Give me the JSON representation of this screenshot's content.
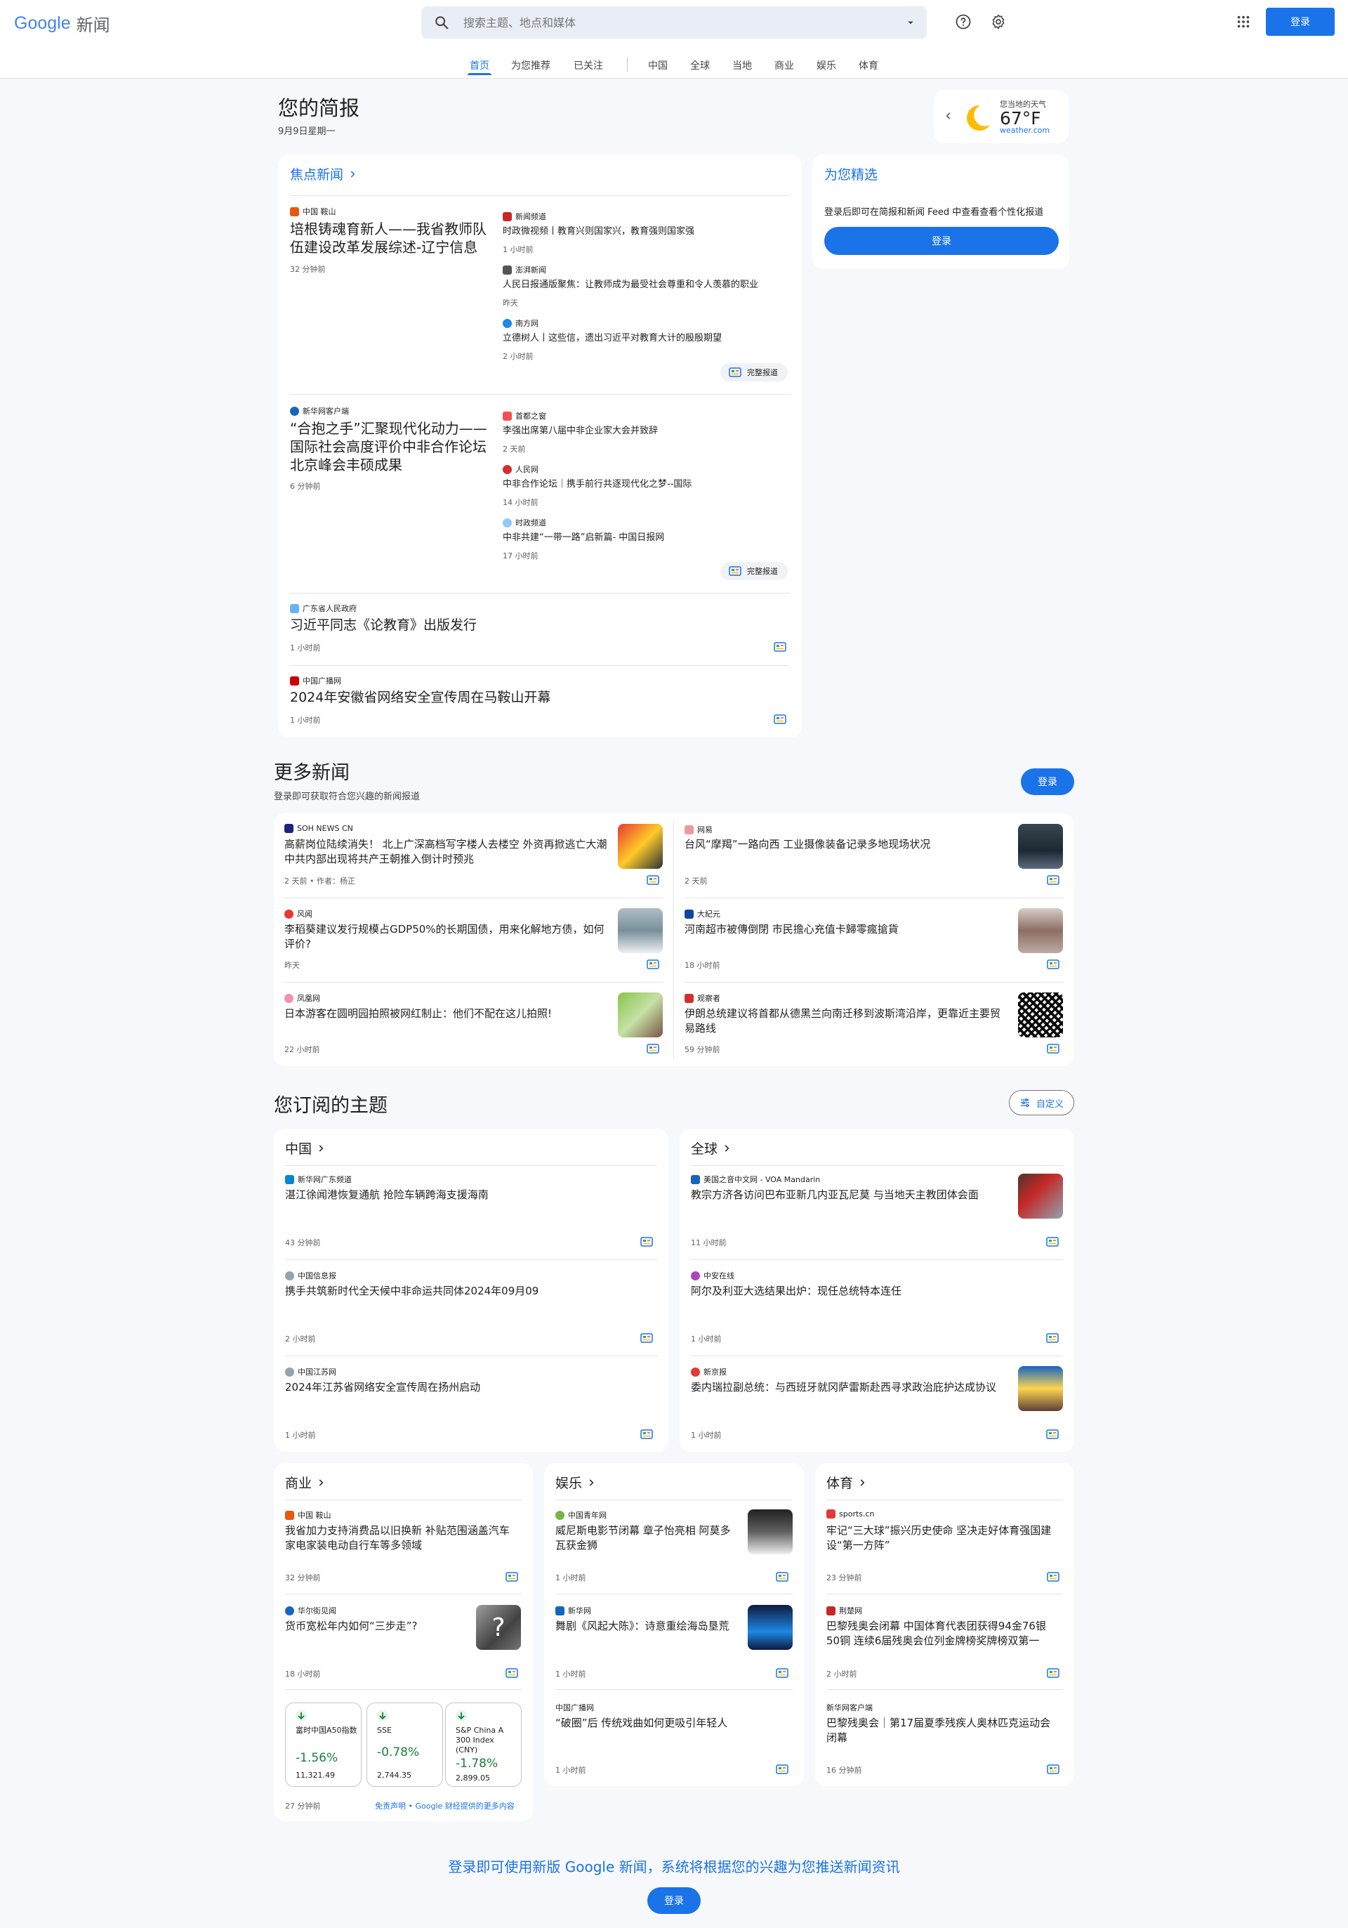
{
  "header": {
    "logo_google": "Google",
    "logo_news": "新闻",
    "search_placeholder": "搜索主题、地点和媒体",
    "signin": "登录",
    "tabs": [
      "首页",
      "为您推荐",
      "已关注",
      "中国",
      "全球",
      "当地",
      "商业",
      "娱乐",
      "体育"
    ],
    "active_tab": "首页"
  },
  "briefing": {
    "title": "您的简报",
    "date": "9月9日星期一"
  },
  "weather": {
    "label": "您当地的天气",
    "temp": "67°F",
    "source": "weather.com"
  },
  "top_stories": {
    "heading": "焦点新闻",
    "full_coverage": "完整报道",
    "clusters": [
      {
        "main": {
          "source": "中国 鞍山",
          "title": "培根铸魂育新人——我省教师队伍建设改革发展综述-辽宁信息",
          "time": "32 分钟前"
        },
        "related": [
          {
            "source": "新闻频道",
            "title": "时政微视频丨教育兴则国家兴，教育强则国家强",
            "time": "1 小时前"
          },
          {
            "source": "澎湃新闻",
            "title": "人民日报通版聚焦：让教师成为最受社会尊重和令人羡慕的职业",
            "time": "昨天"
          },
          {
            "source": "南方网",
            "title": "立德树人丨这些信，遗出习近平对教育大计的殷殷期望",
            "time": "2 小时前"
          }
        ]
      },
      {
        "main": {
          "source": "新华网客户端",
          "title": "“合抱之手”汇聚现代化动力——国际社会高度评价中非合作论坛北京峰会丰硕成果",
          "time": "6 分钟前"
        },
        "related": [
          {
            "source": "首都之窗",
            "title": "李强出席第八届中非企业家大会并致辞",
            "time": "2 天前"
          },
          {
            "source": "人民网",
            "title": "中非合作论坛｜携手前行共逐现代化之梦--国际",
            "time": "14 小时前"
          },
          {
            "source": "时政频道",
            "title": "中非共建“一带一路”启新篇- 中国日报网",
            "time": "17 小时前"
          }
        ]
      }
    ],
    "singles": [
      {
        "source": "广东省人民政府",
        "title": "习近平同志《论教育》出版发行",
        "time": "1 小时前"
      },
      {
        "source": "中国广播网",
        "title": "2024年安徽省网络安全宣传周在马鞍山开幕",
        "time": "1 小时前"
      }
    ]
  },
  "picks": {
    "title": "为您精选",
    "text": "登录后即可在简报和新闻 Feed 中查看查看个性化报道",
    "button": "登录"
  },
  "more_news": {
    "title": "更多新闻",
    "subtitle": "登录即可获取符合您兴趣的新闻报道",
    "button": "登录",
    "items": [
      {
        "source": "SOH NEWS CN",
        "title": "高薪岗位陆续消失！ 北上广深高档写字楼人去楼空 外资再掀逃亡大潮 中共内部出现将共产王朝推入倒计时预兆",
        "time": "2 天前 • 作者：杨正"
      },
      {
        "source": "网易",
        "title": "台风“摩羯”一路向西 工业摄像装备记录多地现场状况",
        "time": "2 天前"
      },
      {
        "source": "风闻",
        "title": "李稻葵建议发行规模占GDP50%的长期国债，用来化解地方债，如何评价?",
        "time": "昨天"
      },
      {
        "source": "大紀元",
        "title": "河南超市被傳倒閉 市民擔心充值卡歸零瘋搶貨",
        "time": "18 小时前"
      },
      {
        "source": "凤凰网",
        "title": "日本游客在圆明园拍照被网红制止：他们不配在这儿拍照!",
        "time": "22 小时前"
      },
      {
        "source": "观察者",
        "title": "伊朗总统建议将首都从德黑兰向南迁移到波斯湾沿岸，更靠近主要贸易路线",
        "time": "59 分钟前"
      }
    ]
  },
  "topics": {
    "title": "您订阅的主题",
    "customize": "自定义",
    "china": {
      "heading": "中国",
      "items": [
        {
          "source": "新华网广东频道",
          "title": "湛江徐闻港恢复通航 抢险车辆跨海支援海南",
          "time": "43 分钟前"
        },
        {
          "source": "中国信息报",
          "title": "携手共筑新时代全天候中非命运共同体2024年09月09",
          "time": "2 小时前"
        },
        {
          "source": "中国江苏网",
          "title": "2024年江苏省网络安全宣传周在扬州启动",
          "time": "1 小时前"
        }
      ]
    },
    "world": {
      "heading": "全球",
      "items": [
        {
          "source": "美国之音中文网 - VOA Mandarin",
          "title": "教宗方济各访问巴布亚新几内亚瓦尼莫 与当地天主教团体会面",
          "time": "11 小时前"
        },
        {
          "source": "中安在线",
          "title": "阿尔及利亚大选结果出炉：现任总统特本连任",
          "time": "1 小时前"
        },
        {
          "source": "新京报",
          "title": "委内瑞拉副总统：与西班牙就冈萨雷斯赴西寻求政治庇护达成协议",
          "time": "1 小时前"
        }
      ]
    },
    "business": {
      "heading": "商业",
      "items": [
        {
          "source": "中国 鞍山",
          "title": "我省加力支持消费品以旧换新 补贴范围涵盖汽车家电家装电动自行车等多领域",
          "time": "32 分钟前"
        },
        {
          "source": "华尔街见闻",
          "title": "货币宽松年内如何“三步走”?",
          "time": "18 小时前"
        }
      ],
      "stocks": [
        {
          "name": "富时中国A50指数",
          "pct": "-1.56%",
          "value": "11,321.49"
        },
        {
          "name": "SSE",
          "pct": "-0.78%",
          "value": "2,744.35"
        },
        {
          "name": "S&P China A 300 Index (CNY)",
          "pct": "-1.78%",
          "value": "2,899.05"
        }
      ],
      "stocks_time": "27 分钟前",
      "stocks_disclaimer": "免责声明 • Google 财经提供的更多内容"
    },
    "entertainment": {
      "heading": "娱乐",
      "items": [
        {
          "source": "中国青年网",
          "title": "威尼斯电影节闭幕 章子怡亮相 阿莫多瓦获金狮",
          "time": "1 小时前"
        },
        {
          "source": "新华网",
          "title": "舞剧《风起大陈》：诗意重绘海岛垦荒",
          "time": "1 小时前"
        },
        {
          "source": "中国广播网",
          "title": "“破圈”后 传统戏曲如何更吸引年轻人",
          "time": "1 小时前"
        }
      ]
    },
    "sports": {
      "heading": "体育",
      "items": [
        {
          "source": "sports.cn",
          "title": "牢记“三大球”振兴历史使命 坚决走好体育强国建设“第一方阵”",
          "time": "23 分钟前"
        },
        {
          "source": "荆楚网",
          "title": "巴黎残奥会闭幕 中国体育代表团获得94金76银50铜 连续6届残奥会位列金牌榜奖牌榜双第一",
          "time": "2 小时前"
        },
        {
          "source": "新华网客户端",
          "title": "巴黎残奥会｜第17届夏季残疾人奥林匹克运动会闭幕",
          "time": "16 分钟前"
        }
      ]
    }
  },
  "footer": {
    "text": "登录即可使用新版 Google 新闻，系统将根据您的兴趣为您推送新闻资讯",
    "button": "登录"
  },
  "colors": {
    "accent": "#1a73e8",
    "page_bg": "#f6f8fc",
    "card_bg": "#ffffff",
    "stock_down": "#188038"
  }
}
